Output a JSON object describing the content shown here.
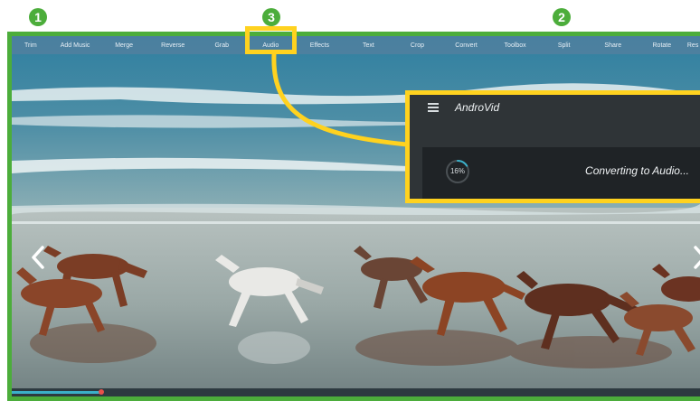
{
  "badges": {
    "first": "1",
    "second": "2",
    "third": "3"
  },
  "toolbar": {
    "items": [
      "Trim",
      "Add Music",
      "Merge",
      "Reverse",
      "Grab",
      "Audio",
      "Effects",
      "Text",
      "Crop",
      "Convert",
      "Toolbox",
      "Split",
      "Share",
      "Rotate",
      "Res"
    ]
  },
  "popup": {
    "app_title": "AndroVid",
    "progress": 16,
    "progress_label": "16%",
    "status": "Converting to Audio..."
  },
  "playback": {
    "position": 0.13
  },
  "colors": {
    "annotation_green": "#4cad3b",
    "highlight_yellow": "#ffd21f",
    "dialog_background": "#2f3437",
    "progress_accent": "#3bb0c9"
  },
  "icons": {
    "previous": "chevron-left-icon",
    "next": "chevron-right-icon",
    "menu": "hamburger-menu-icon"
  }
}
